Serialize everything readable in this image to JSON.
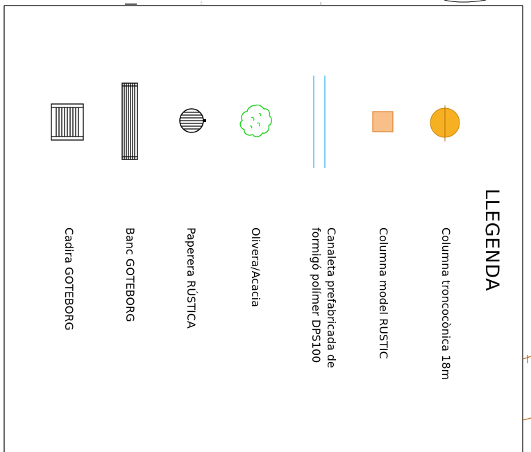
{
  "legend": {
    "title": "LLEGENDA",
    "items": [
      {
        "symbol": "conical-column-icon",
        "label": "Columna troncocònica 18m",
        "color": "#f6b022"
      },
      {
        "symbol": "rustic-column-icon",
        "label": "Columna model RUSTIC",
        "color": "#f9bf88"
      },
      {
        "symbol": "channel-icon",
        "label_line1": "Canaleta prefabricada de",
        "label_line2": "formigó polímer DPS100",
        "color": "#36b6f0"
      },
      {
        "symbol": "tree-icon",
        "label": "Olivera/Acacia",
        "color": "#1fd21f"
      },
      {
        "symbol": "bin-icon",
        "label": "Paperera RÚSTICA",
        "color": "#000000"
      },
      {
        "symbol": "bench-icon",
        "label": "Banc GOTEBORG",
        "color": "#000000"
      },
      {
        "symbol": "chair-icon",
        "label": "Cadira GOTEBORG",
        "color": "#000000"
      }
    ]
  }
}
